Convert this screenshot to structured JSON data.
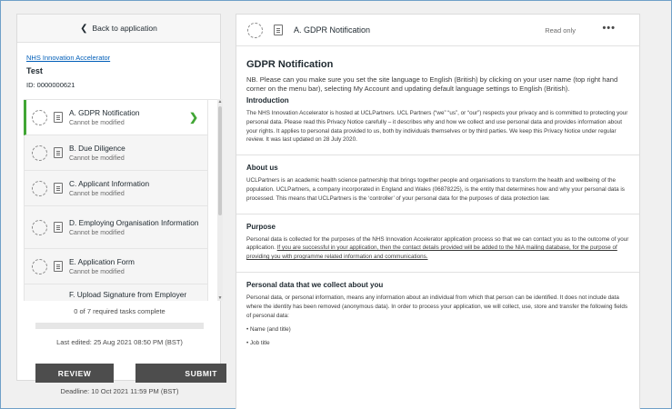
{
  "sidebar": {
    "back_label": "Back to application",
    "project_link": "NHS Innovation Accelerator",
    "project_name": "Test",
    "project_id": "ID: 0000000621",
    "tasks": [
      {
        "title": "A. GDPR Notification",
        "status": "Cannot be modified",
        "active": true
      },
      {
        "title": "B. Due Diligence",
        "status": "Cannot be modified"
      },
      {
        "title": "C. Applicant Information",
        "status": "Cannot be modified"
      },
      {
        "title": "D. Employing Organisation Information",
        "status": "Cannot be modified"
      },
      {
        "title": "E. Application Form",
        "status": "Cannot be modified"
      },
      {
        "title": "F. Upload Signature from Employer",
        "status": ""
      }
    ],
    "progress_text": "0 of 7 required tasks complete",
    "progress_fraction": 0,
    "last_edited": "Last edited: 25 Aug 2021 08:50 PM (BST)",
    "review_label": "REVIEW",
    "submit_label": "SUBMIT",
    "deadline": "Deadline: 10 Oct 2021 11:59 PM (BST)"
  },
  "main": {
    "header_title": "A. GDPR Notification",
    "read_only": "Read only",
    "more": "•••",
    "heading": "GDPR Notification",
    "nb": "NB. Please can you make sure you set the site language to English (British) by clicking on your user name (top right hand corner on the menu bar), selecting My Account and updating default language settings to English (British).",
    "intro_heading": "Introduction",
    "intro_text": "The NHS Innovation Accelerator is hosted at UCLPartners. UCL Partners (“we” “us”, or “our”) respects your privacy and is committed to protecting your personal data. Please read this Privacy Notice carefully – it describes why and how we collect and use personal data and provides information about your rights. It applies to personal data provided to us, both by individuals themselves or by third parties. We keep this Privacy Notice under regular review. It was last updated on 28 July 2020.",
    "about_heading": "About us",
    "about_text": "UCLPartners is an academic health science partnership that brings together people and organisations to transform the health and wellbeing of the population. UCLPartners, a company incorporated in England and Wales (06878225), is the entity that determines how and why your personal data is processed. This means that UCLPartners is the ‘controller’ of your personal data for the purposes of data protection law.",
    "purpose_heading": "Purpose",
    "purpose_text_a": "Personal data is collected for the purposes of the NHS Innovation Accelerator application process so that we can contact you as to the outcome of your application. ",
    "purpose_text_b": "If you are successful in your application, then the contact details provided will be added to the NIA mailing database, for the purpose of providing you with programme related information and communications.",
    "collect_heading": "Personal data that we collect about you",
    "collect_text": "Personal data, or personal information, means any information about an individual from which that person can be identified. It does not include data where the identity has been removed (anonymous data). In order to process your application, we will collect, use, store and transfer the following fields of personal data:",
    "bullets": [
      "• Name (and title)",
      "• Job title"
    ]
  }
}
